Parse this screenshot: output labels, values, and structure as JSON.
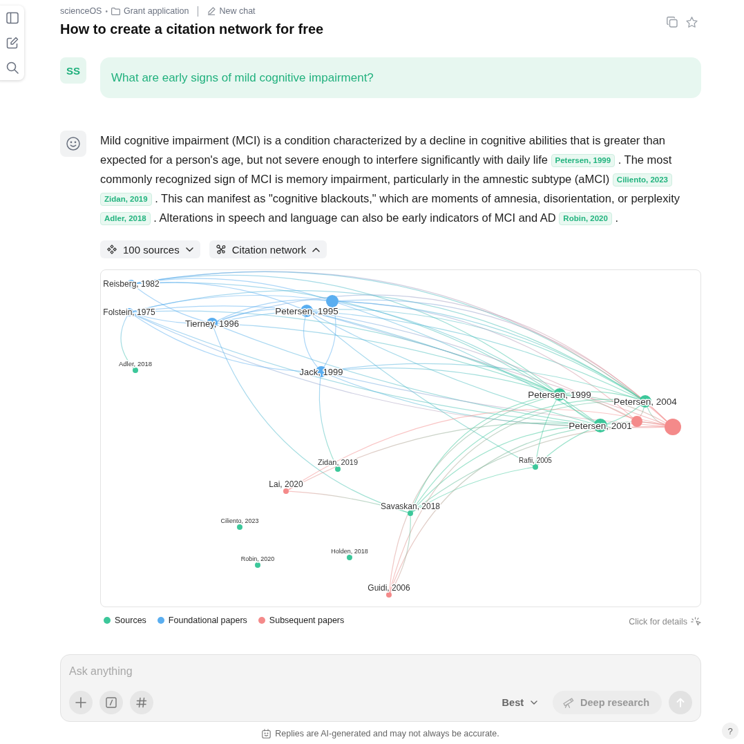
{
  "breadcrumb": {
    "workspace": "scienceOS",
    "separator": "•",
    "folder": "Grant application",
    "chat": "New chat"
  },
  "title": "How to create a citation network for free",
  "question": {
    "avatar": "SS",
    "text": "What are early signs of mild cognitive impairment?"
  },
  "answer": {
    "parts": [
      {
        "kind": "text",
        "text": "Mild cognitive impairment (MCI) is a condition characterized by a decline in cognitive abilities that is greater than expected for a person's age, but not severe enough to interfere significantly with daily life"
      },
      {
        "kind": "citation",
        "text": "Petersen, 1999"
      },
      {
        "kind": "text",
        "text": ". The most commonly recognized sign of MCI is memory impairment, particularly in the amnestic subtype (aMCI)"
      },
      {
        "kind": "citation",
        "text": "Ciliento, 2023"
      },
      {
        "kind": "citation",
        "text": "Zidan, 2019"
      },
      {
        "kind": "text",
        "text": ". This can manifest as \"cognitive blackouts,\" which are moments of amnesia, disorientation, or perplexity"
      },
      {
        "kind": "citation",
        "text": "Adler, 2018"
      },
      {
        "kind": "text",
        "text": ". Alterations in speech and language can also be early indicators of MCI and AD"
      },
      {
        "kind": "citation",
        "text": "Robin, 2020"
      },
      {
        "kind": "text",
        "text": "."
      }
    ]
  },
  "toggles": [
    {
      "kind": "sources",
      "label": "100 sources",
      "expanded": false
    },
    {
      "kind": "network",
      "label": "Citation network",
      "expanded": true
    }
  ],
  "network": {
    "nodes": [
      {
        "label": "Reisberg, 1982",
        "color": "#5aaef0"
      },
      {
        "label": "Folstein, 1975",
        "color": "#5aaef0"
      },
      {
        "label": "Tierney, 1996",
        "color": "#5aaef0"
      },
      {
        "label": "Petersen, 1995",
        "color": "#5aaef0"
      },
      {
        "color": "#5aaef0"
      },
      {
        "label": "Jack, 1999",
        "color": "#5aaef0"
      },
      {
        "label": "Adler, 2018",
        "color": "#3cc79a"
      },
      {
        "label": "Zidan, 2019",
        "color": "#3cc79a"
      },
      {
        "label": "Lai, 2020",
        "color": "#f48a8a"
      },
      {
        "label": "Savaskan, 2018",
        "color": "#3cc79a"
      },
      {
        "label": "Ciliento, 2023",
        "color": "#3cc79a"
      },
      {
        "label": "Robin, 2020",
        "color": "#3cc79a"
      },
      {
        "label": "Holden, 2018",
        "color": "#3cc79a"
      },
      {
        "label": "Guidi, 2006",
        "color": "#f48a8a"
      },
      {
        "label": "Rafii, 2005",
        "color": "#3cc79a"
      },
      {
        "label": "Petersen, 1999",
        "color": "#3cc79a"
      },
      {
        "label": "Petersen, 2004",
        "color": "#3cc79a"
      },
      {
        "label": "Petersen, 2001",
        "color": "#3cc79a"
      },
      {
        "color": "#f48a8a"
      },
      {
        "color": "#f48a8a"
      }
    ],
    "legend": [
      {
        "label": "Sources",
        "color": "#3cc79a"
      },
      {
        "label": "Foundational papers",
        "color": "#5aaef0"
      },
      {
        "label": "Subsequent papers",
        "color": "#f48a8a"
      }
    ],
    "hint": "Click for details"
  },
  "composer": {
    "placeholder": "Ask anything",
    "model": "Best",
    "deep_research": {
      "label": "Deep research",
      "disabled": true
    },
    "send": {
      "disabled": true
    }
  },
  "disclaimer": "Replies are AI-generated and may not always be accurate.",
  "help": "?"
}
